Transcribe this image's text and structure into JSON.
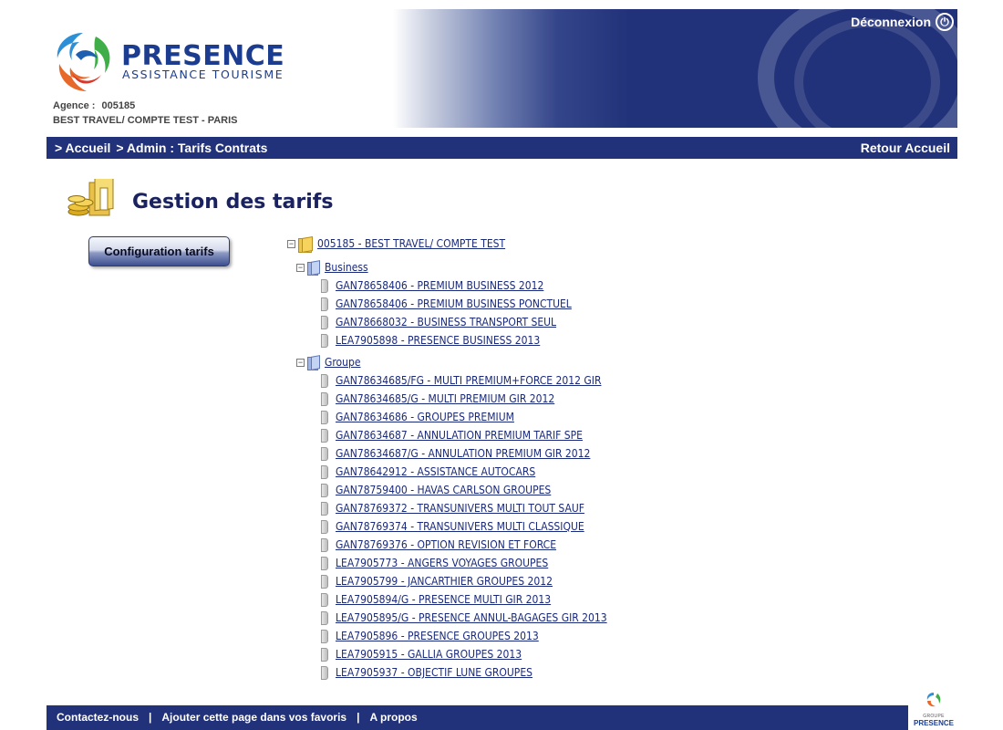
{
  "header": {
    "brand_name": "PRESENCE",
    "brand_sub": "ASSISTANCE TOURISME",
    "agency_label": "Agence :",
    "agency_code": "005185",
    "agency_name": "BEST TRAVEL/ COMPTE TEST - PARIS",
    "logout_label": "Déconnexion",
    "logout_icon": "power-icon",
    "brand_color": "#1c3d8f",
    "band_color": "#22327a"
  },
  "nav": {
    "breadcrumb": [
      "> Accueil",
      "> Admin : Tarifs Contrats"
    ],
    "back_label": "Retour Accueil"
  },
  "page": {
    "title": "Gestion des tarifs",
    "title_icon": "coins-folder-icon",
    "config_button": "Configuration tarifs"
  },
  "tree": {
    "root": "005185 - BEST TRAVEL/ COMPTE TEST",
    "groups": [
      {
        "label": "Business",
        "items": [
          "GAN78658406 - PREMIUM BUSINESS 2012",
          "GAN78658406 - PREMIUM BUSINESS PONCTUEL",
          "GAN78668032 - BUSINESS TRANSPORT SEUL",
          "LEA7905898 - PRESENCE BUSINESS 2013"
        ]
      },
      {
        "label": "Groupe",
        "items": [
          "GAN78634685/FG - MULTI PREMIUM+FORCE 2012 GIR",
          "GAN78634685/G - MULTI PREMIUM GIR 2012",
          "GAN78634686 - GROUPES PREMIUM",
          "GAN78634687 - ANNULATION PREMIUM TARIF SPE",
          "GAN78634687/G - ANNULATION PREMIUM GIR 2012",
          "GAN78642912 - ASSISTANCE AUTOCARS",
          "GAN78759400 - HAVAS CARLSON GROUPES",
          "GAN78769372 - TRANSUNIVERS MULTI TOUT SAUF",
          "GAN78769374 - TRANSUNIVERS MULTI CLASSIQUE",
          "GAN78769376 - OPTION REVISION ET FORCE",
          "LEA7905773 - ANGERS VOYAGES GROUPES",
          "LEA7905799 - JANCARTHIER GROUPES 2012",
          "LEA7905894/G - PRESENCE MULTI GIR 2013",
          "LEA7905895/G - PRESENCE ANNUL-BAGAGES GIR 2013",
          "LEA7905896 - PRESENCE GROUPES 2013",
          "LEA7905915 - GALLIA GROUPES 2013",
          "LEA7905937 - OBJECTIF LUNE GROUPES"
        ]
      }
    ]
  },
  "footer": {
    "links": [
      "Contactez-nous",
      "Ajouter cette page dans vos favoris",
      "A propos"
    ],
    "separator": "|",
    "group_logo_small": "GROUPE",
    "group_logo_big": "PRESENCE"
  }
}
